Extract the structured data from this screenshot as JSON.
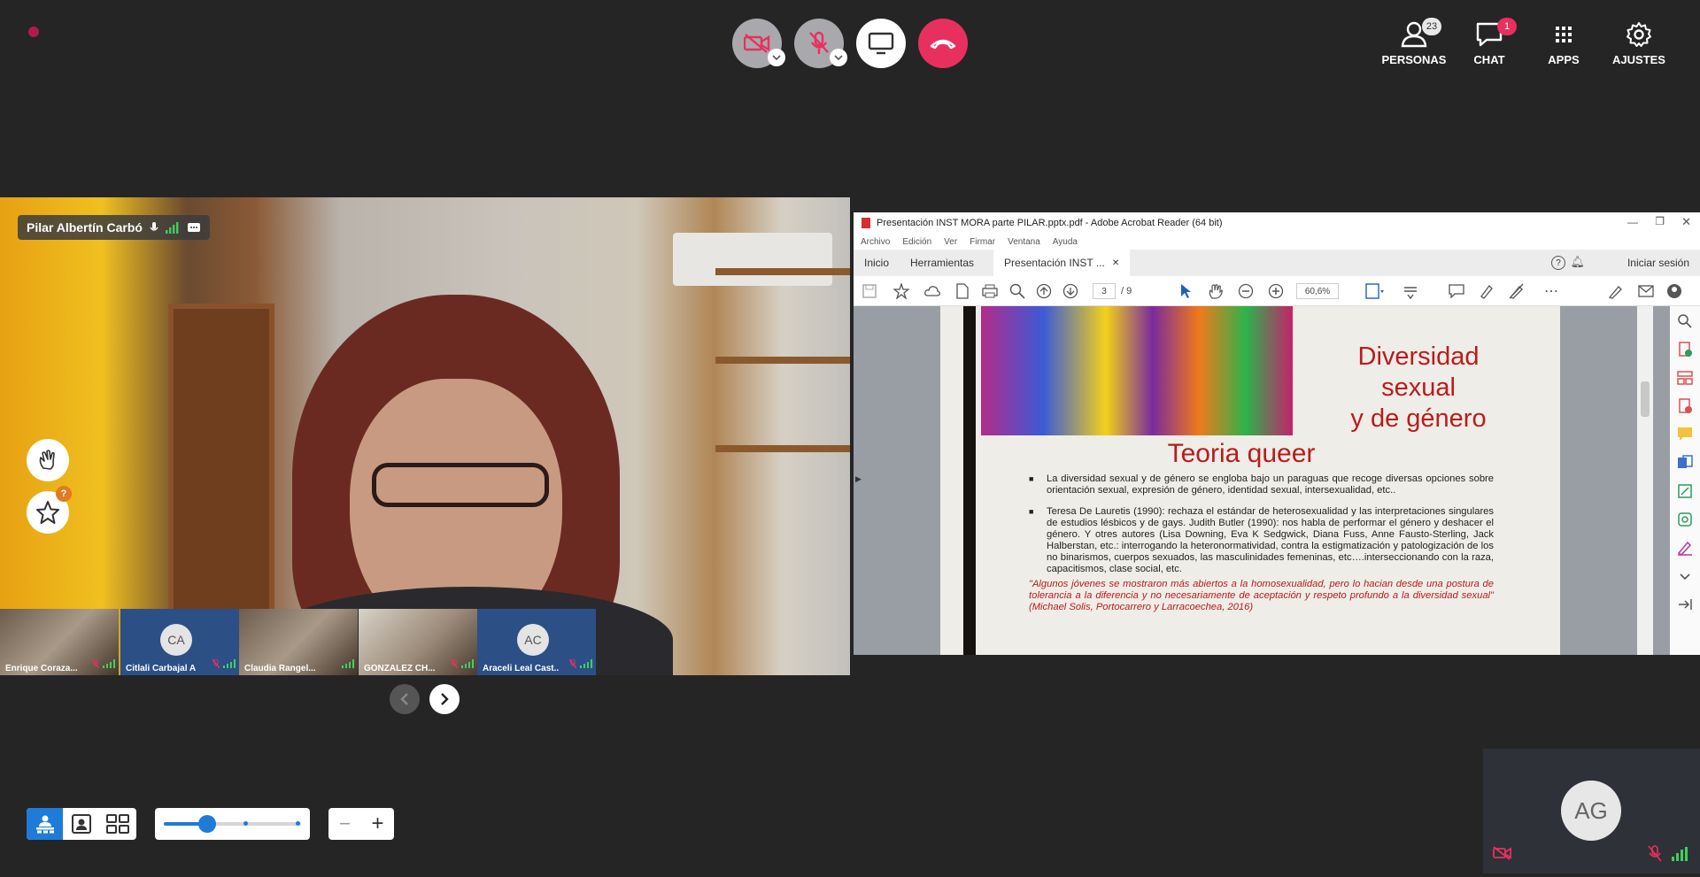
{
  "top_bar": {
    "recording_color": "#b01c4a",
    "people": {
      "label": "PERSONAS",
      "count": "23",
      "icon": "people-icon"
    },
    "chat": {
      "label": "CHAT",
      "count": "1",
      "icon": "chat-icon"
    },
    "apps": {
      "label": "APPS",
      "icon": "apps-grid-icon"
    },
    "settings": {
      "label": "AJUSTES",
      "icon": "gear-icon"
    },
    "controls": {
      "camera": "camera-off-icon",
      "microphone": "mic-off-icon",
      "share": "screen-share-icon",
      "hangup": "hangup-icon"
    }
  },
  "main_speaker": {
    "name": "Pilar Albertín Carbó"
  },
  "thumbnails": [
    {
      "name": "Enrique Coraza...",
      "kind": "photo"
    },
    {
      "name": "Citlali Carbajal A",
      "kind": "avatar",
      "initials": "CA"
    },
    {
      "name": "Claudia Rangel...",
      "kind": "photo"
    },
    {
      "name": "GONZALEZ CH...",
      "kind": "photo"
    },
    {
      "name": "Araceli Leal Cast...",
      "kind": "avatar",
      "initials": "AC"
    }
  ],
  "shared_screen": {
    "window_title": "Presentación INST MORA parte PILAR.pptx.pdf - Adobe Acrobat Reader (64 bit)",
    "menu": [
      "Archivo",
      "Edición",
      "Ver",
      "Firmar",
      "Ventana",
      "Ayuda"
    ],
    "tabs": {
      "home": "Inicio",
      "tools": "Herramientas",
      "document": "Presentación INST ...",
      "sign_in": "Iniciar sesión"
    },
    "toolbar": {
      "page_current": "3",
      "page_total": "/ 9",
      "zoom": "60,6%"
    },
    "slide": {
      "title_line1": "Diversidad sexual",
      "title_line2": "y de género",
      "heading": "Teoria queer",
      "bullet1": "La diversidad sexual y de género se engloba bajo un paraguas que recoge diversas opciones sobre orientación sexual, expresión de género, identidad sexual, intersexualidad, etc..",
      "bullet2": "Teresa De Lauretis (1990): rechaza el estándar de heterosexualidad y las interpretaciones singulares de estudios lésbicos y de gays. Judith Butler (1990): nos habla de performar el género y deshacer el género. Y otres autores (Lisa Downing, Eva K Sedgwick, Diana Fuss, Anne Fausto-Sterling, Jack Halberstan, etc.: interrogando la heteronormatividad, contra la estigmatización y patologización de los no binarismos, cuerpos sexuados, las masculinidades femeninas, etc….interseccionando con la raza, capacitismos, clase social, etc.",
      "quote": "\"Algunos jóvenes se mostraron más abiertos a la homosexualidad, pero lo hacian desde una postura de tolerancia a la diferencia y no necesariamente de aceptación y respeto profundo a la diversidad sexual\" (Michael Solis, Portocarrero y Larracoechea, 2016)",
      "accent_color": "#b91c1c"
    }
  },
  "self_view": {
    "initials": "AG"
  },
  "layout_controls": {
    "zoom_minus": "−",
    "zoom_plus": "+"
  }
}
